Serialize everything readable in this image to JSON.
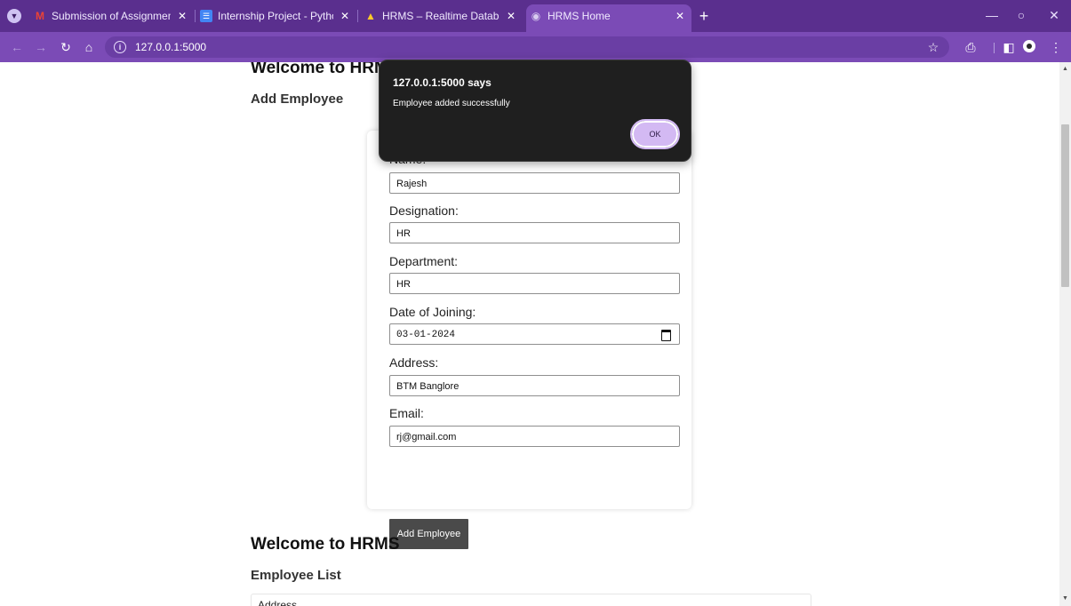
{
  "browser": {
    "tabs": [
      {
        "title": "Submission of Assignment for I",
        "favicon": "gmail-icon",
        "active": false
      },
      {
        "title": "Internship Project - Python - Go",
        "favicon": "docs-icon",
        "active": false
      },
      {
        "title": "HRMS – Realtime Database – Fi",
        "favicon": "firebase-icon",
        "active": false
      },
      {
        "title": "HRMS Home",
        "favicon": "globe-icon",
        "active": true
      }
    ],
    "url": "127.0.0.1:5000",
    "accent_color": "#7b4bb6",
    "tabstrip_color": "#5a2f8e"
  },
  "page": {
    "heading_top": "Welcome to HRMS",
    "add_section_title": "Add Employee",
    "form": {
      "name_label": "Name:",
      "name_value": "Rajesh",
      "designation_label": "Designation:",
      "designation_value": "HR",
      "department_label": "Department:",
      "department_value": "HR",
      "doj_label": "Date of Joining:",
      "doj_value": "03-01-2024",
      "address_label": "Address:",
      "address_value": "BTM Banglore",
      "email_label": "Email:",
      "email_value": "rj@gmail.com",
      "submit_label": "Add Employee"
    },
    "heading_bottom": "Welcome to HRMS",
    "list_section_title": "Employee List",
    "list_first_row_partial": "Address"
  },
  "dialog": {
    "title": "127.0.0.1:5000 says",
    "message": "Employee added successfully",
    "ok_label": "OK",
    "button_color": "#d3b9f3"
  }
}
